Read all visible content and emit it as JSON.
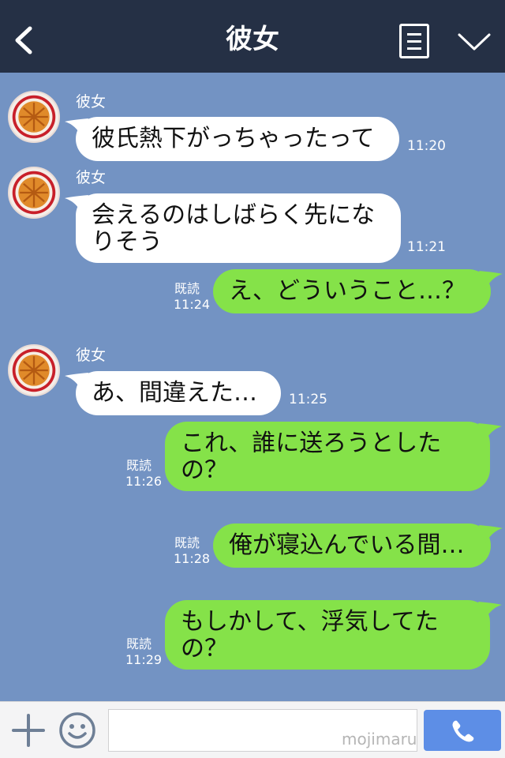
{
  "header": {
    "title": "彼女"
  },
  "messages": [
    {
      "side": "in",
      "sender": "彼女",
      "text": "彼氏熱下がっちゃったって",
      "time": "11:20"
    },
    {
      "side": "in",
      "sender": "彼女",
      "text": "会えるのはしばらく先になりそう",
      "time": "11:21"
    },
    {
      "side": "out",
      "read": "既読",
      "text": "え、どういうこと…？",
      "time": "11:24"
    },
    {
      "side": "in",
      "sender": "彼女",
      "text": "あ、間違えた…",
      "time": "11:25"
    },
    {
      "side": "out",
      "read": "既読",
      "text": "これ、誰に送ろうとしたの？",
      "time": "11:26"
    },
    {
      "side": "out",
      "read": "既読",
      "text": "俺が寝込んでいる間…",
      "time": "11:28"
    },
    {
      "side": "out",
      "read": "既読",
      "text": "もしかして、浮気してたの？",
      "time": "11:29"
    }
  ],
  "footer": {
    "input_placeholder": "",
    "watermark": "mojimaru"
  },
  "colors": {
    "header": "#253045",
    "chat_bg": "#7393c3",
    "incoming_bubble": "#ffffff",
    "outgoing_bubble": "#85e249",
    "call_button": "#5d8ee6"
  },
  "icons": [
    "back-chevron-icon",
    "menu-list-icon",
    "chevron-down-icon",
    "plus-icon",
    "smiley-icon",
    "phone-icon",
    "pie-avatar-icon"
  ]
}
